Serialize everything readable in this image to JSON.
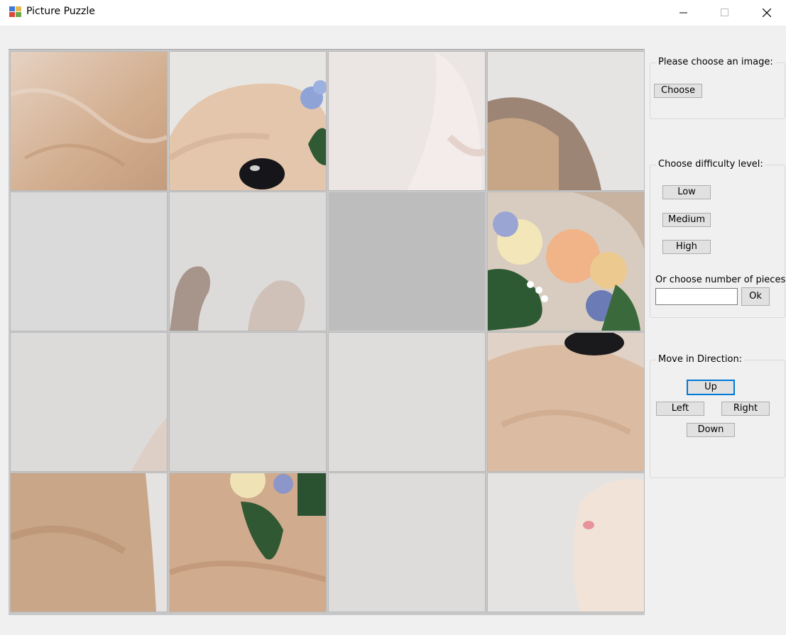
{
  "window": {
    "title": "Picture Puzzle",
    "icon": "app-puzzle-icon",
    "controls": [
      "minimize-icon",
      "maximize-icon",
      "close-icon"
    ]
  },
  "image_group": {
    "title": "Please choose an image:",
    "choose_label": "Choose"
  },
  "difficulty_group": {
    "title": "Choose difficulty level:",
    "low_label": "Low",
    "medium_label": "Medium",
    "high_label": "High",
    "pieces_label": "Or choose number of pieces:",
    "pieces_value": "",
    "ok_label": "Ok"
  },
  "direction_group": {
    "title": "Move in Direction:",
    "up_label": "Up",
    "left_label": "Left",
    "right_label": "Right",
    "down_label": "Down"
  },
  "board": {
    "rows": 4,
    "cols": 4,
    "empty_tile": "row 2, col 3",
    "tiles": [
      "fur-closeup",
      "rabbit-eye-with-blue-flower",
      "white-fur",
      "rabbit-back-grey",
      "light-grey-background",
      "rabbit-ears-tips",
      "empty",
      "flower-crown-orange-rose",
      "light-grey-background",
      "light-grey-background",
      "light-grey-background",
      "rabbit-eye-fur",
      "rabbit-side-fur",
      "rabbit-head-with-leaves",
      "light-grey-background",
      "rabbit-nose"
    ]
  }
}
